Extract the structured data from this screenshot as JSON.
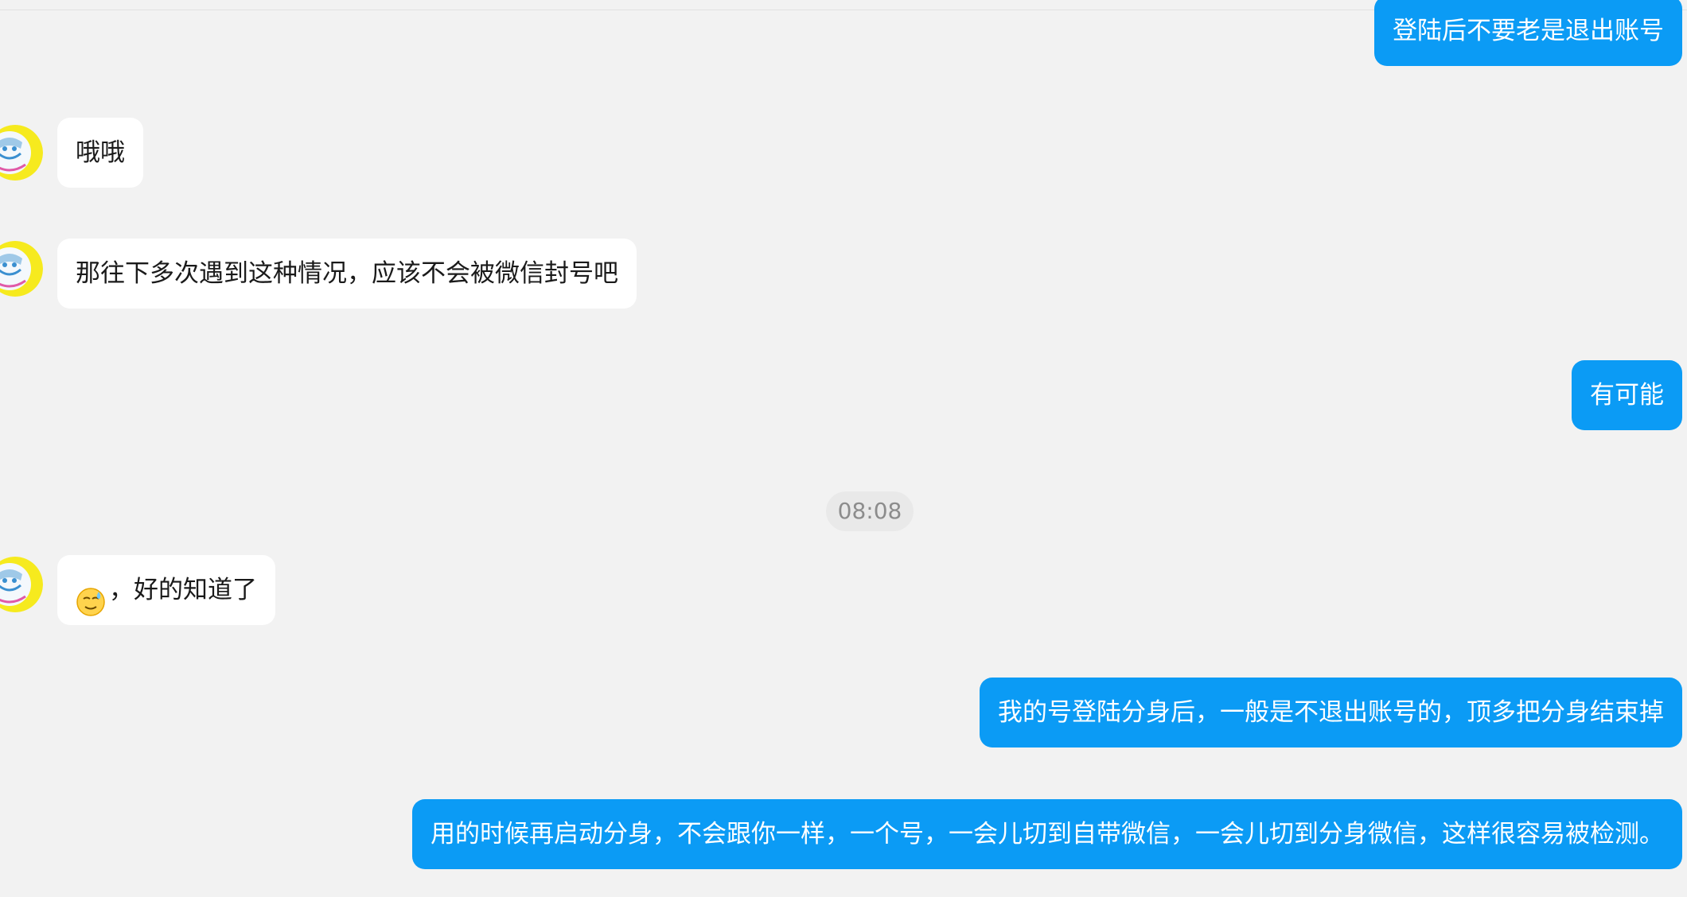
{
  "chat": {
    "messages": [
      {
        "id": "m1",
        "direction": "out",
        "text": "登陆后不要老是退出账号"
      },
      {
        "id": "m2",
        "direction": "in",
        "text": "哦哦"
      },
      {
        "id": "m3",
        "direction": "in",
        "text": "那往下多次遇到这种情况，应该不会被微信封号吧"
      },
      {
        "id": "m4",
        "direction": "out",
        "text": "有可能"
      },
      {
        "id": "m5",
        "direction": "in",
        "emoji": "sweat-smile-emoji",
        "text": "，好的知道了"
      },
      {
        "id": "m6",
        "direction": "out",
        "text": "我的号登陆分身后，一般是不退出账号的，顶多把分身结束掉"
      },
      {
        "id": "m7",
        "direction": "out",
        "text": "用的时候再启动分身，不会跟你一样，一个号，一会儿切到自带微信，一会儿切到分身微信，这样很容易被检测。"
      }
    ],
    "timestamp": "08:08"
  },
  "colors": {
    "background": "#f2f2f2",
    "incoming_bubble": "#ffffff",
    "outgoing_bubble": "#0b9bf5",
    "timestamp_chip": "#e9e9e9"
  },
  "icons": {
    "avatar": "contact-avatar-icon",
    "emoji": "sweat-smile-emoji"
  }
}
